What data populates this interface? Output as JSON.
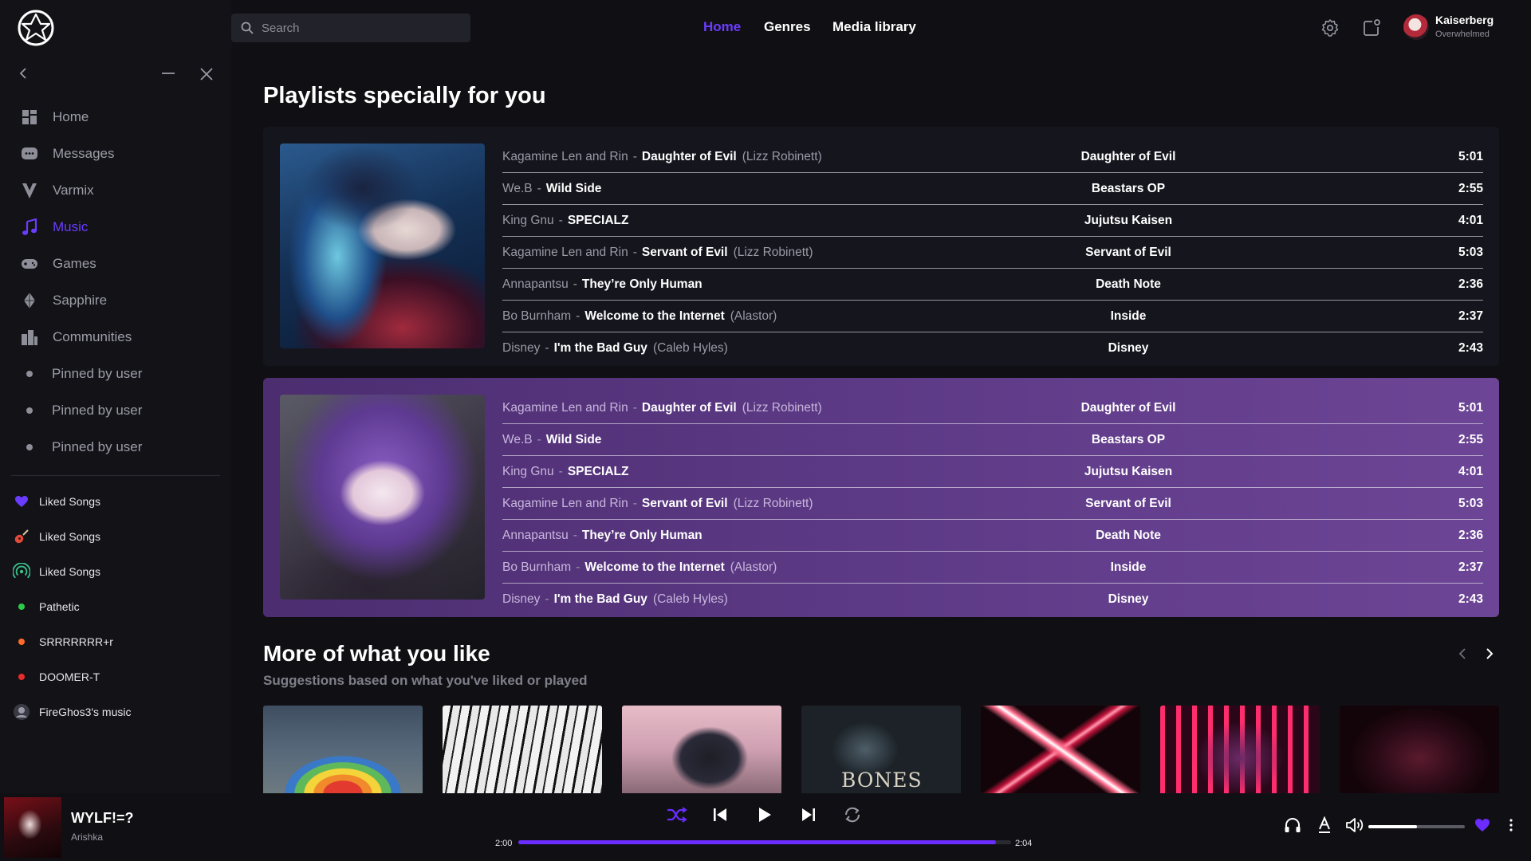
{
  "search": {
    "placeholder": "Search"
  },
  "topnav": [
    {
      "label": "Home",
      "active": true
    },
    {
      "label": "Genres"
    },
    {
      "label": "Media library"
    }
  ],
  "user": {
    "name": "Kaiserberg",
    "status": "Overwhelmed"
  },
  "sidebar": {
    "nav": [
      {
        "label": "Home",
        "icon": "grid-icon"
      },
      {
        "label": "Messages",
        "icon": "chat-icon"
      },
      {
        "label": "Varmix",
        "icon": "varmix-icon"
      },
      {
        "label": "Music",
        "icon": "music-note-icon",
        "active": true
      },
      {
        "label": "Games",
        "icon": "gamepad-icon"
      },
      {
        "label": "Sapphire",
        "icon": "gem-icon"
      },
      {
        "label": "Communities",
        "icon": "buildings-icon"
      },
      {
        "label": "Pinned by user",
        "icon": "dot-icon"
      },
      {
        "label": "Pinned by user",
        "icon": "dot-icon"
      },
      {
        "label": "Pinned by user",
        "icon": "dot-icon"
      }
    ],
    "playlists": [
      {
        "label": "Liked Songs",
        "icon": "heart-icon",
        "color": "#6a3cff"
      },
      {
        "label": "Liked Songs",
        "icon": "guitar-icon",
        "color": "#e04a3a"
      },
      {
        "label": "Liked Songs",
        "icon": "radio-icon",
        "color": "#3ac28a"
      },
      {
        "label": "Pathetic",
        "icon": "dot-icon",
        "color": "#2ec84a"
      },
      {
        "label": "SRRRRRRR+r",
        "icon": "dot-icon",
        "color": "#ff6a2a"
      },
      {
        "label": "DOOMER-T",
        "icon": "dot-icon",
        "color": "#e82a2a"
      },
      {
        "label": "FireGhos3's music",
        "icon": "avatar-icon",
        "color": "#8a8a94"
      }
    ]
  },
  "main": {
    "heading": "Playlists specially for you",
    "playlists": [
      {
        "tracks": [
          {
            "artist": "Kagamine Len and Rin",
            "title": "Daughter of Evil",
            "feat": "(Lizz Robinett)",
            "album": "Daughter of Evil",
            "duration": "5:01"
          },
          {
            "artist": "We.B",
            "title": "Wild Side",
            "feat": "",
            "album": "Beastars OP",
            "duration": "2:55"
          },
          {
            "artist": "King Gnu",
            "title": "SPECIALZ",
            "feat": "",
            "album": "Jujutsu Kaisen",
            "duration": "4:01"
          },
          {
            "artist": "Kagamine Len and Rin",
            "title": "Servant of Evil",
            "feat": "(Lizz Robinett)",
            "album": "Servant of Evil",
            "duration": "5:03"
          },
          {
            "artist": "Annapantsu",
            "title": "They’re Only Human",
            "feat": "",
            "album": "Death Note",
            "duration": "2:36"
          },
          {
            "artist": "Bo Burnham",
            "title": "Welcome to the Internet",
            "feat": "(Alastor)",
            "album": "Inside",
            "duration": "2:37"
          },
          {
            "artist": "Disney",
            "title": "I'm the Bad Guy",
            "feat": "(Caleb Hyles)",
            "album": "Disney",
            "duration": "2:43"
          }
        ]
      },
      {
        "tracks": [
          {
            "artist": "Kagamine Len and Rin",
            "title": "Daughter of Evil",
            "feat": "(Lizz Robinett)",
            "album": "Daughter of Evil",
            "duration": "5:01"
          },
          {
            "artist": "We.B",
            "title": "Wild Side",
            "feat": "",
            "album": "Beastars OP",
            "duration": "2:55"
          },
          {
            "artist": "King Gnu",
            "title": "SPECIALZ",
            "feat": "",
            "album": "Jujutsu Kaisen",
            "duration": "4:01"
          },
          {
            "artist": "Kagamine Len and Rin",
            "title": "Servant of Evil",
            "feat": "(Lizz Robinett)",
            "album": "Servant of Evil",
            "duration": "5:03"
          },
          {
            "artist": "Annapantsu",
            "title": "They’re Only Human",
            "feat": "",
            "album": "Death Note",
            "duration": "2:36"
          },
          {
            "artist": "Bo Burnham",
            "title": "Welcome to the Internet",
            "feat": "(Alastor)",
            "album": "Inside",
            "duration": "2:37"
          },
          {
            "artist": "Disney",
            "title": "I'm the Bad Guy",
            "feat": "(Caleb Hyles)",
            "album": "Disney",
            "duration": "2:43"
          }
        ]
      }
    ],
    "more": {
      "heading": "More of what you like",
      "subheading": "Suggestions based on what you've liked or played",
      "thumb_text": "BONES"
    }
  },
  "player": {
    "title": "WYLF!=?",
    "artist": "Arishka",
    "elapsed": "2:00",
    "total": "2:04",
    "progress": 0.97,
    "volume": 0.5,
    "accent": "#6a2cff"
  }
}
